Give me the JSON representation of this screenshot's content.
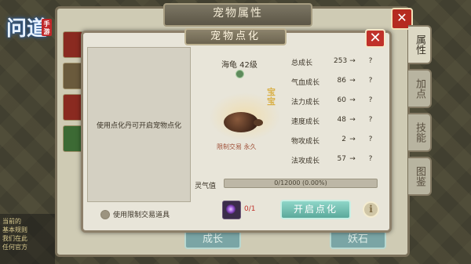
{
  "background": {
    "logo_text": "问道",
    "logo_badge": "手游",
    "chat_lines": [
      "当前的",
      "基本规则",
      "我们在此",
      "任何官方"
    ]
  },
  "outer_panel": {
    "title": "宠物属性",
    "close_label": "✕",
    "tabs": [
      "属性",
      "加点",
      "技能",
      "图鉴"
    ],
    "bottom_buttons": [
      "成长",
      "妖石"
    ]
  },
  "dialog": {
    "title": "宠物点化",
    "close_label": "✕",
    "left_hint": "使用点化丹可开启宠物点化",
    "checkbox_label": "使用限制交易道具",
    "pet": {
      "name": "海龟 42级",
      "baby_tag": "宝宝",
      "trade_label": "限制交易 永久"
    },
    "stats": [
      {
        "label": "总成长",
        "value": "253",
        "arrow": "→",
        "new": "?"
      },
      {
        "label": "气血成长",
        "value": "86",
        "arrow": "→",
        "new": "?"
      },
      {
        "label": "法力成长",
        "value": "60",
        "arrow": "→",
        "new": "?"
      },
      {
        "label": "速度成长",
        "value": "48",
        "arrow": "→",
        "new": "?"
      },
      {
        "label": "物攻成长",
        "value": "2",
        "arrow": "→",
        "new": "?"
      },
      {
        "label": "法攻成长",
        "value": "57",
        "arrow": "→",
        "new": "?"
      }
    ],
    "energy": {
      "label": "灵气值",
      "text": "0/12000 (0.00%)",
      "fraction": 0
    },
    "item": {
      "icon": "purple-orb-icon",
      "count": "0/1"
    },
    "open_button": "开启点化",
    "info_button": "i"
  },
  "colors": {
    "accent_green": "#5ba99b",
    "close_red": "#c0312a",
    "panel_bg": "#e8e5d9"
  }
}
